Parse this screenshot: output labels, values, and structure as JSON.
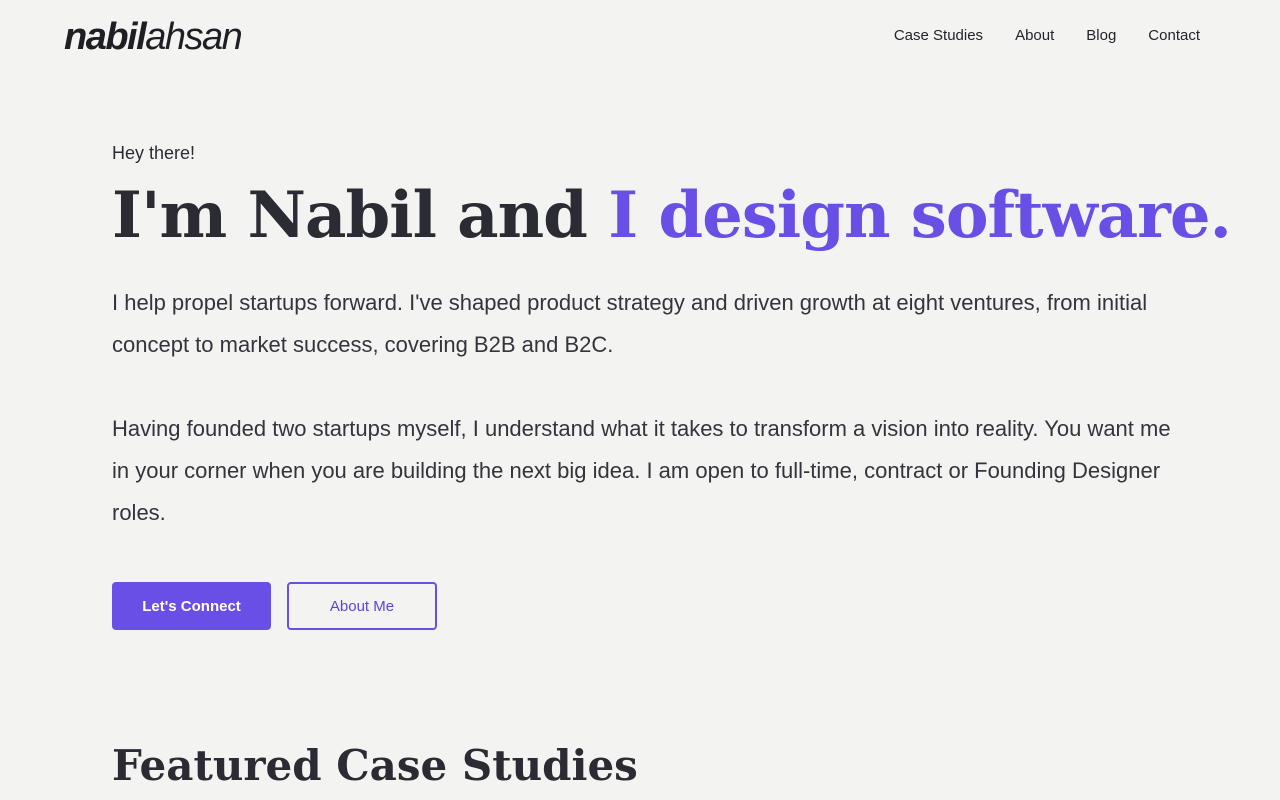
{
  "header": {
    "logo_bold": "nabil",
    "logo_light": "ahsan",
    "nav": [
      {
        "label": "Case Studies"
      },
      {
        "label": "About"
      },
      {
        "label": "Blog"
      },
      {
        "label": "Contact"
      }
    ]
  },
  "hero": {
    "eyebrow": "Hey there!",
    "headline_plain": "I'm Nabil and ",
    "headline_accent": "I design software.",
    "paragraph_1": "I help propel startups forward. I've shaped product strategy and driven growth at eight ventures, from initial concept to market success, covering B2B and B2C.",
    "paragraph_2": "Having founded two startups myself, I understand what it takes to transform a vision into reality. You want me in your corner when you are building the next big idea. I am open to full-time, contract or Founding Designer roles.",
    "primary_button": "Let's Connect",
    "secondary_button": "About Me"
  },
  "featured": {
    "title": "Featured Case Studies"
  },
  "colors": {
    "accent": "#6a4fe6",
    "background": "#f3f3f2",
    "text": "#2b2b33"
  }
}
